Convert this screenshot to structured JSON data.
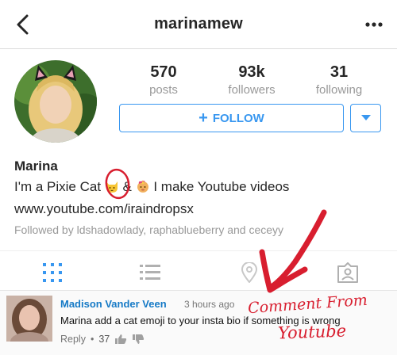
{
  "header": {
    "username": "marinamew",
    "back_icon": "chevron-left-icon",
    "more_icon": "more-dots-icon"
  },
  "stats": [
    {
      "value": "570",
      "label": "posts"
    },
    {
      "value": "93k",
      "label": "followers"
    },
    {
      "value": "31",
      "label": "following"
    }
  ],
  "profile": {
    "follow_label": "FOLLOW",
    "name": "Marina",
    "bio_before": "I'm a Pixie Cat",
    "bio_amp": "&",
    "bio_after": "I make Youtube videos",
    "link": "www.youtube.com/iraindropsx",
    "followed_by": "Followed by ldshadowlady, raphablueberry and ceceyy"
  },
  "tabs": [
    "grid-icon",
    "list-icon",
    "location-icon",
    "tagged-icon"
  ],
  "comment": {
    "author": "Madison Vander Veen",
    "time": "3 hours ago",
    "text": "Marina add a cat emoji to your insta bio if something is wrong",
    "reply_label": "Reply",
    "separator": "•",
    "likes": "37"
  },
  "annotation": {
    "line1": "Comment From",
    "line2": "Youtube",
    "color": "#d81e2f"
  },
  "colors": {
    "accent": "#3897f0",
    "comment_author": "#167ac6",
    "annotation": "#d81e2f"
  }
}
